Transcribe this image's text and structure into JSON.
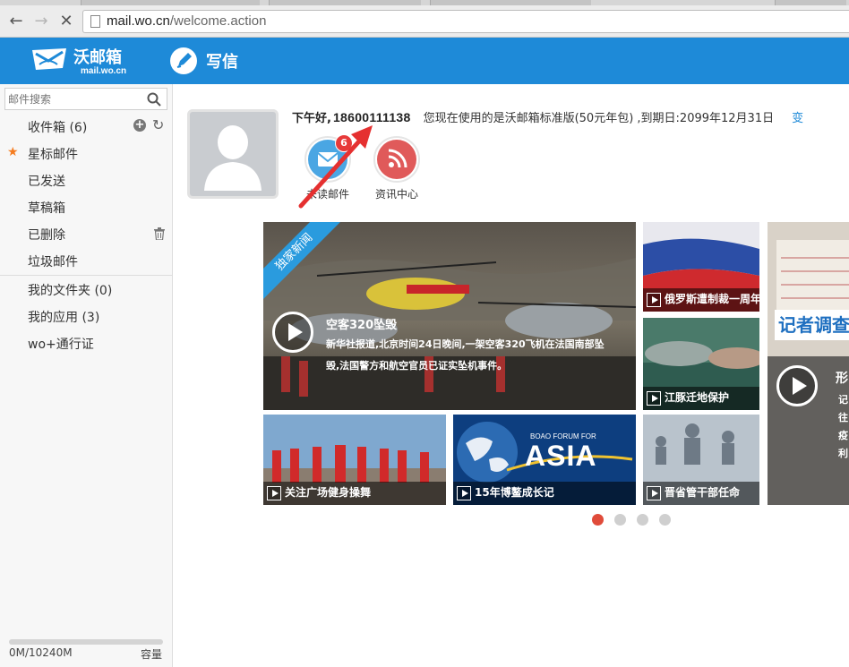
{
  "browser": {
    "url_host": "mail.wo.cn",
    "url_path": "/welcome.action"
  },
  "header": {
    "logo_title": "沃邮箱",
    "logo_sub": "mail.wo.cn",
    "compose_label": "写信"
  },
  "sidebar": {
    "search_placeholder": "邮件搜索",
    "folders": [
      {
        "label": "收件箱 (6)"
      },
      {
        "label": "星标邮件"
      },
      {
        "label": "已发送"
      },
      {
        "label": "草稿箱"
      },
      {
        "label": "已删除"
      },
      {
        "label": "垃圾邮件"
      }
    ],
    "extras": [
      {
        "label": "我的文件夹 (0)"
      },
      {
        "label": "我的应用 (3)"
      },
      {
        "label": "wo+通行证"
      }
    ],
    "quota_text": "0M/10240M",
    "quota_label": "容量",
    "quota_used_fraction": 0
  },
  "main": {
    "greeting_hello": "下午好,",
    "greeting_phone": "18600111138",
    "greeting_info": "您现在使用的是沃邮箱标准版(50元年包) ,到期日:2099年12月31日",
    "greeting_link": "变",
    "quick": [
      {
        "label": "未读邮件",
        "badge": "6",
        "icon": "mail-icon",
        "color": "#4aa6e3"
      },
      {
        "label": "资讯中心",
        "icon": "rss-icon",
        "color": "#e05a5a"
      }
    ],
    "news_main": {
      "ribbon": "独家新闻",
      "title": "空客320坠毁",
      "desc_line1": "新华社报道,北京时间24日晚间,一架空客320飞机在法国南部坠",
      "desc_line2": "毁,法国警方和航空官员已证实坠机事件。"
    },
    "tiles": [
      {
        "caption": "俄罗斯遭制裁一周年"
      },
      {
        "caption": "江豚迁地保护"
      },
      {
        "caption": "关注广场健身操舞"
      },
      {
        "caption": "15年博鳌成长记"
      },
      {
        "caption": "晋省管干部任命"
      }
    ],
    "side_feature": {
      "banner": "记者调查",
      "lines": [
        "形",
        "记",
        "往",
        "疫",
        "利"
      ]
    },
    "boao_small": "BOAO FORUM FOR",
    "boao_big": "ASIA",
    "pager_count": 4,
    "pager_active": 1
  }
}
